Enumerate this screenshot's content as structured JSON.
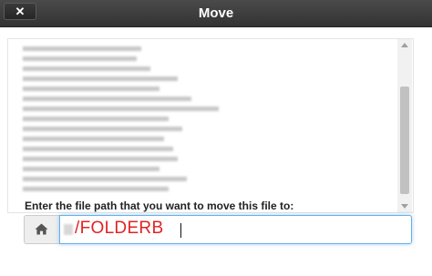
{
  "dialog": {
    "title": "Move",
    "close_label": "✕"
  },
  "file_list": {
    "blurred_line_count": 15
  },
  "form": {
    "prompt": "Enter the file path that you want to move this file to:",
    "path_value": "/FOLDERB",
    "addon_icon": "home-icon"
  },
  "colors": {
    "titlebar": "#333333",
    "input_text": "#e02424",
    "focus_border": "#66afe9"
  }
}
